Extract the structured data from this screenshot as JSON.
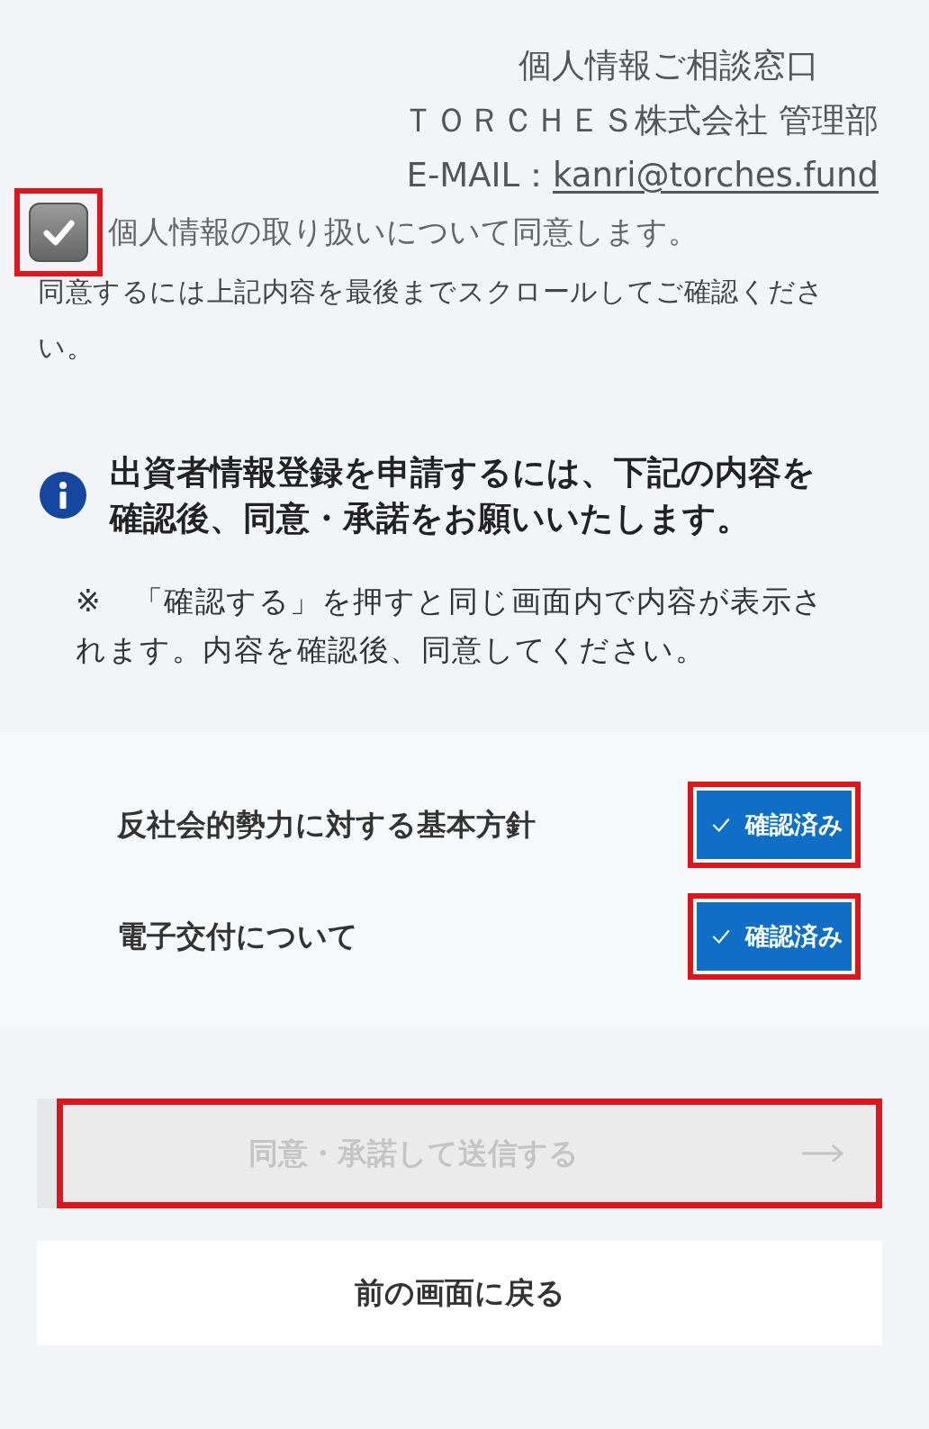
{
  "contact": {
    "lines": [
      "個人情報ご相談窓口",
      "ＴＯＲＣＨＥＳ株式会社 管理部"
    ],
    "email_label": "E-MAIL：",
    "email": "kanri@torches.fund"
  },
  "consent": {
    "label": "個人情報の取り扱いについて同意します。",
    "checked": true,
    "highlighted": true,
    "note": "同意するには上記内容を最後までスクロールしてご確認ください。"
  },
  "notice": {
    "heading": "出資者情報登録を申請するには、下記の内容を確認後、同意・承諾をお願いいたします。",
    "note": "※　「確認する」を押すと同じ画面内で内容が表示されます。内容を確認後、同意してください。"
  },
  "documents": [
    {
      "title": "反社会的勢力に対する基本方針",
      "status": "確認済み",
      "confirmed": true,
      "highlighted": true
    },
    {
      "title": "電子交付について",
      "status": "確認済み",
      "confirmed": true,
      "highlighted": true
    }
  ],
  "submit": {
    "label": "同意・承諾して送信する",
    "disabled": true,
    "highlighted": true
  },
  "back": {
    "label": "前の画面に戻る"
  }
}
